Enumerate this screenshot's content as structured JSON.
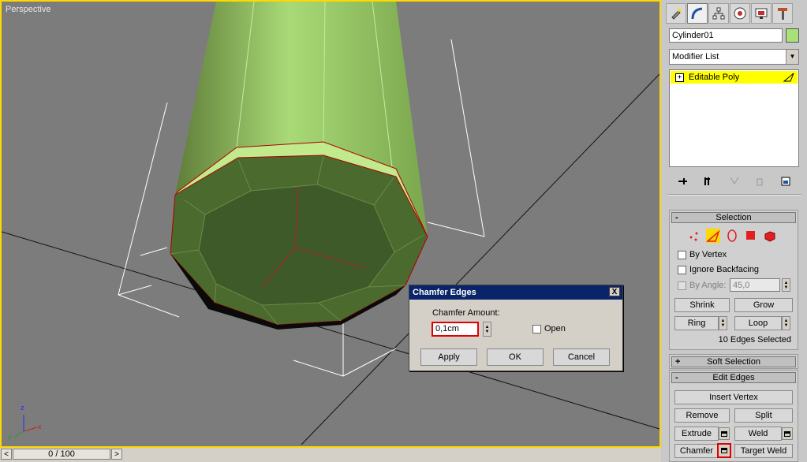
{
  "viewport": {
    "label": "Perspective",
    "axis_x": "x",
    "axis_y": "y",
    "axis_z": "z"
  },
  "timeline": {
    "slider_text": "0 / 100",
    "prev": "<",
    "next": ">"
  },
  "command_panel": {
    "tabs": [
      "create-icon",
      "modify-icon",
      "hierarchy-icon",
      "motion-icon",
      "display-icon",
      "utilities-icon"
    ],
    "active_tab": "modify-icon",
    "object_name": "Cylinder01",
    "object_color": "#a8e07a",
    "modifier_list": "Modifier List",
    "stack_item": "Editable Poly"
  },
  "selection": {
    "title": "Selection",
    "collapse": "-",
    "by_vertex": "By Vertex",
    "ignore_backfacing": "Ignore Backfacing",
    "by_angle": "By Angle:",
    "angle_value": "45,0",
    "shrink": "Shrink",
    "grow": "Grow",
    "ring": "Ring",
    "loop": "Loop",
    "status": "10 Edges Selected"
  },
  "soft_selection": {
    "title": "Soft Selection",
    "expand": "+"
  },
  "edit_edges": {
    "title": "Edit Edges",
    "collapse": "-",
    "insert_vertex": "Insert Vertex",
    "remove": "Remove",
    "split": "Split",
    "extrude": "Extrude",
    "weld": "Weld",
    "chamfer": "Chamfer",
    "target_weld": "Target Weld"
  },
  "dialog": {
    "title": "Chamfer Edges",
    "close": "X",
    "amount_label": "Chamfer Amount:",
    "amount_value": "0,1cm",
    "open_label": "Open",
    "apply": "Apply",
    "ok": "OK",
    "cancel": "Cancel"
  }
}
